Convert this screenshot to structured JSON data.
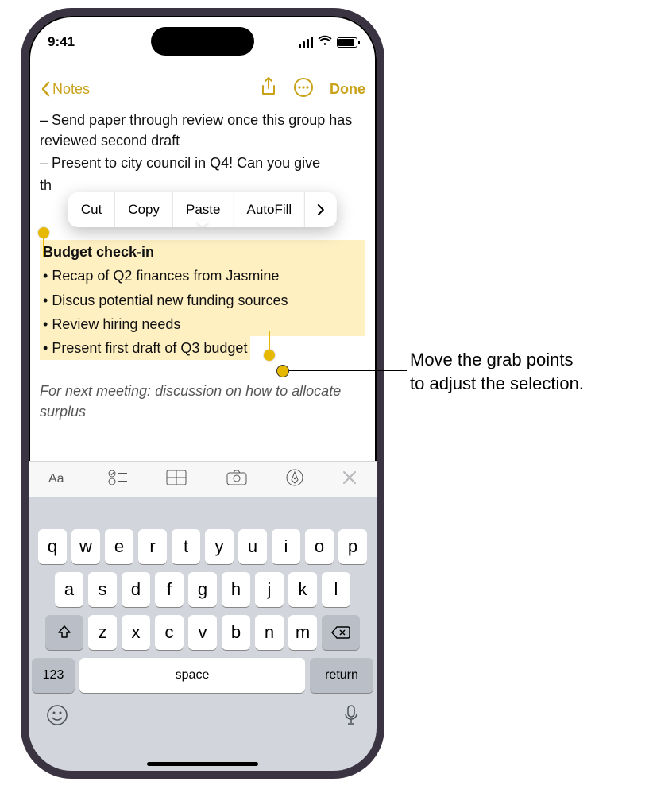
{
  "status": {
    "time": "9:41"
  },
  "nav": {
    "back_label": "Notes",
    "done_label": "Done"
  },
  "note": {
    "line1_prefix": "– ",
    "line1": "Send paper through review once this group has reviewed second draft",
    "line2_prefix": "– ",
    "line2": "Present to city council in Q4! Can you give",
    "line2b": "th",
    "sel_title": "Budget check-in",
    "sel_items": [
      "Recap of Q2 finances from Jasmine",
      "Discus potential new funding sources",
      "Review hiring needs",
      "Present first draft of Q3 budget"
    ],
    "italic": "For next meeting: discussion on how to allocate surplus"
  },
  "menu": {
    "cut": "Cut",
    "copy": "Copy",
    "paste": "Paste",
    "autofill": "AutoFill"
  },
  "keyboard": {
    "row1": [
      "q",
      "w",
      "e",
      "r",
      "t",
      "y",
      "u",
      "i",
      "o",
      "p"
    ],
    "row2": [
      "a",
      "s",
      "d",
      "f",
      "g",
      "h",
      "j",
      "k",
      "l"
    ],
    "row3": [
      "z",
      "x",
      "c",
      "v",
      "b",
      "n",
      "m"
    ],
    "numkey": "123",
    "space": "space",
    "return": "return"
  },
  "callout": {
    "line1": "Move the grab points",
    "line2": "to adjust the selection."
  }
}
